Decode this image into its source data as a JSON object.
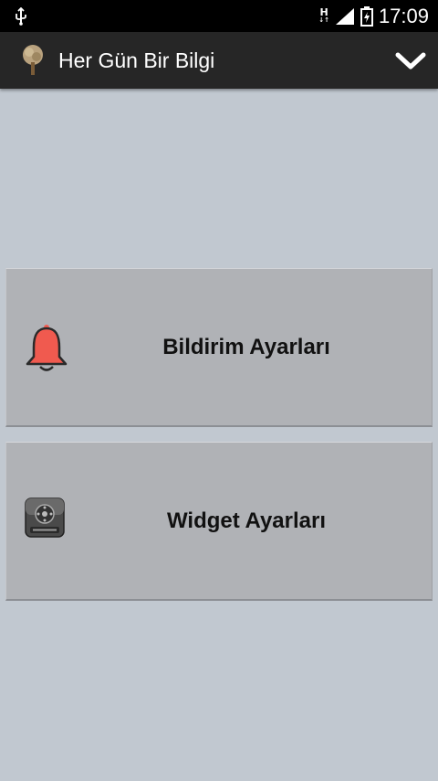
{
  "status_bar": {
    "network_type": "H",
    "time": "17:09"
  },
  "action_bar": {
    "title": "Her Gün Bir Bilgi"
  },
  "menu": {
    "items": [
      {
        "label": "Bildirim Ayarları",
        "icon": "bell-icon"
      },
      {
        "label": "Widget Ayarları",
        "icon": "widgets-icon"
      }
    ]
  },
  "colors": {
    "background": "#c1c8d0",
    "action_bar": "#262626",
    "card": "#b0b2b6",
    "bell": "#f05a4f"
  }
}
